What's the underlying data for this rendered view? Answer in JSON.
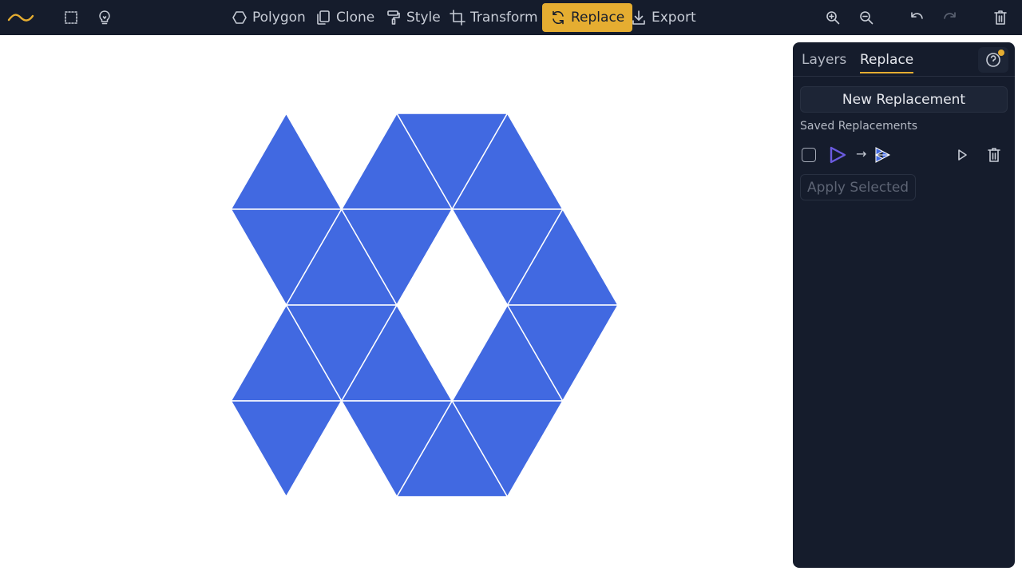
{
  "toolbar": {
    "logo_icon": "wave-logo-icon",
    "select_icon": "dashed-rect-select-icon",
    "hint_icon": "lightbulb-icon",
    "items": [
      {
        "label": "Polygon",
        "icon": "hexagon-icon"
      },
      {
        "label": "Clone",
        "icon": "copy-icon"
      },
      {
        "label": "Style",
        "icon": "paint-roller-icon"
      },
      {
        "label": "Transform",
        "icon": "crop-icon"
      },
      {
        "label": "Replace",
        "icon": "refresh-icon"
      },
      {
        "label": "Export",
        "icon": "download-icon"
      }
    ],
    "active_item": "Replace",
    "zoom_in_icon": "zoom-in-icon",
    "zoom_out_icon": "zoom-out-icon",
    "undo_icon": "undo-icon",
    "redo_icon": "redo-icon",
    "delete_icon": "trash-icon"
  },
  "panel": {
    "tabs": [
      {
        "label": "Layers"
      },
      {
        "label": "Replace"
      }
    ],
    "active_tab": "Replace",
    "help_icon": "help-circle-icon",
    "new_replacement_label": "New Replacement",
    "saved_heading": "Saved Replacements",
    "replacements": [
      {
        "from_shape": "triangle",
        "to_shape": "subdivided-triangle",
        "arrow": "→",
        "checked": false
      }
    ],
    "apply_selected_label": "Apply Selected"
  },
  "colors": {
    "toolbar_bg": "#151c2c",
    "accent": "#e5ad31",
    "tile_fill": "#4169e1",
    "tile_stroke": "#ffffff",
    "canvas_bg": "#ffffff",
    "replacement_from": "#6b5be0"
  },
  "tiling": {
    "shape": "hexagon",
    "rings": 2,
    "filled_count": 18,
    "empty_count": 6
  }
}
